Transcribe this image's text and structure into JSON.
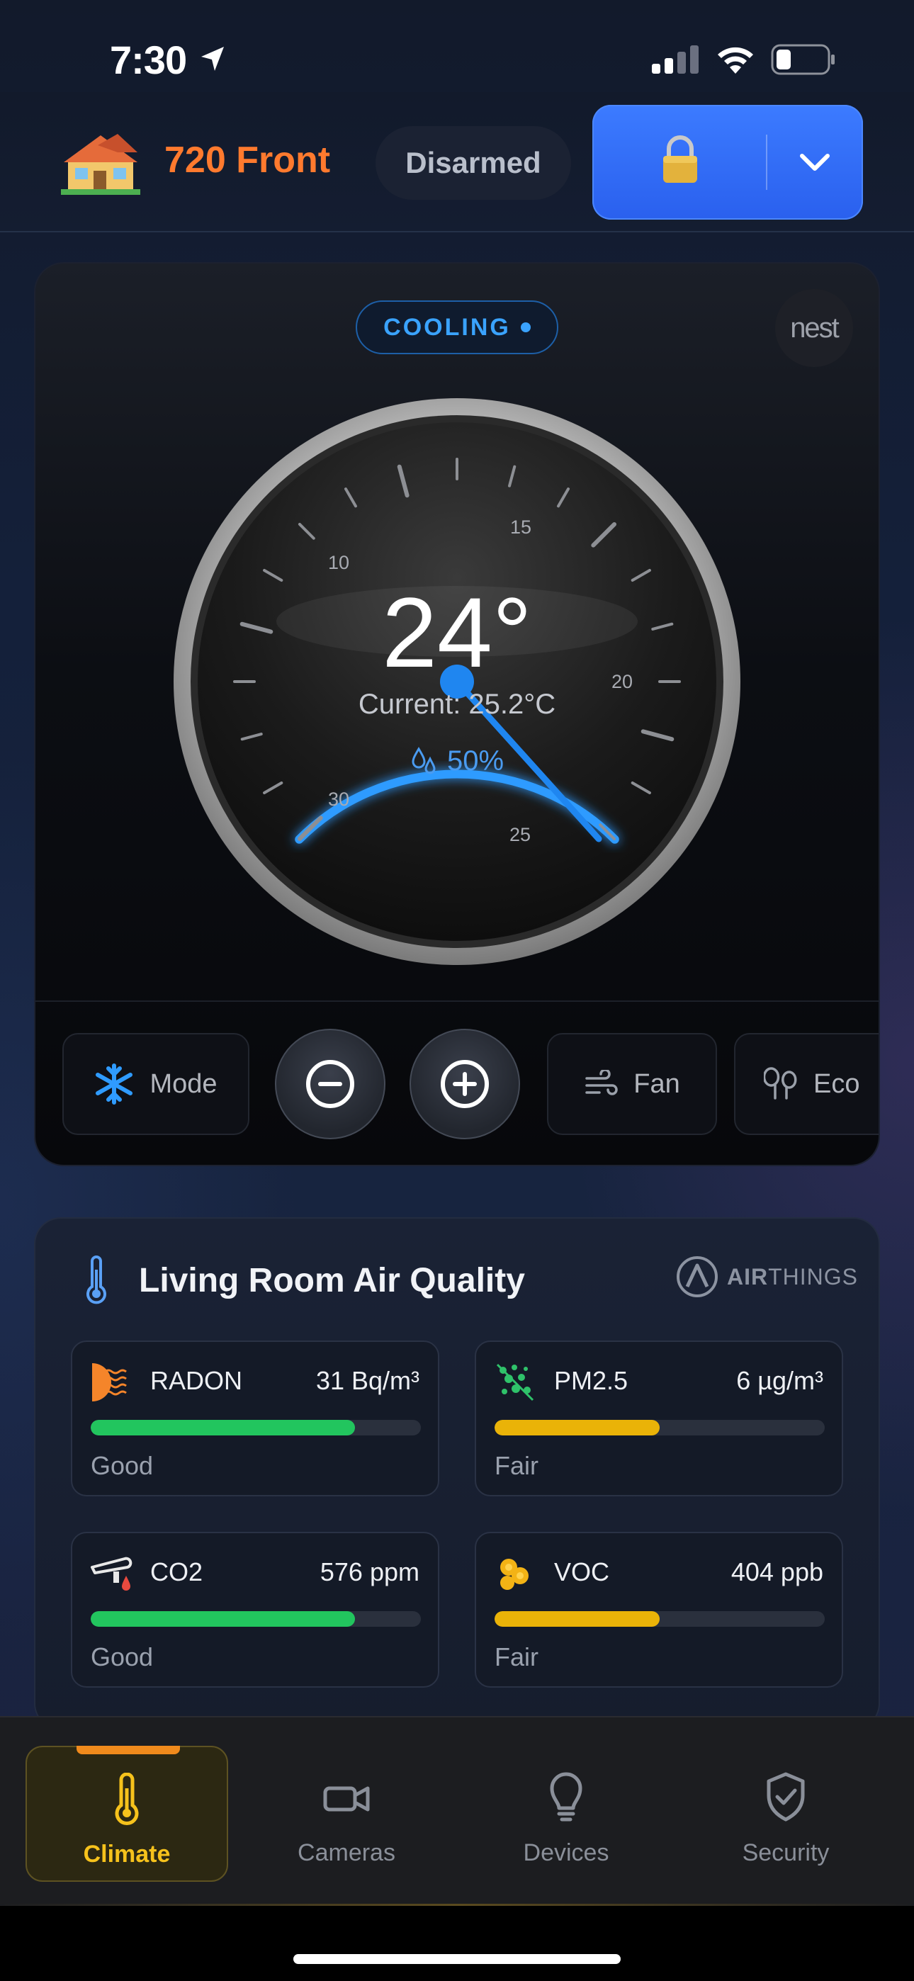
{
  "status_bar": {
    "time": "7:30"
  },
  "header": {
    "location_name": "720 Front",
    "arm_state": "Disarmed"
  },
  "thermostat": {
    "mode_label": "COOLING",
    "brand_badge": "nest",
    "target_temp": "24°",
    "current_temp": "Current: 25.2°C",
    "humidity": "50%",
    "scale_labels": [
      "10",
      "15",
      "20",
      "25",
      "30"
    ],
    "accent_color": "#2f9bff",
    "controls": {
      "mode_label": "Mode",
      "fan_label": "Fan",
      "eco_label": "Eco"
    }
  },
  "air_quality": {
    "title": "Living Room Air Quality",
    "brand": {
      "bold": "AIR",
      "rest": "THINGS"
    },
    "metrics": [
      {
        "name": "RADON",
        "value": "31 Bq/m³",
        "status": "Good",
        "level": 0.8,
        "color": "#22c55e",
        "icon": "radon-icon"
      },
      {
        "name": "PM2.5",
        "value": "6 µg/m³",
        "status": "Fair",
        "level": 0.5,
        "color": "#eab308",
        "icon": "pm25-icon"
      },
      {
        "name": "CO2",
        "value": "576 ppm",
        "status": "Good",
        "level": 0.8,
        "color": "#22c55e",
        "icon": "co2-icon"
      },
      {
        "name": "VOC",
        "value": "404 ppb",
        "status": "Fair",
        "level": 0.5,
        "color": "#eab308",
        "icon": "voc-icon"
      }
    ]
  },
  "tab_bar": {
    "tabs": [
      {
        "label": "Climate",
        "icon": "thermometer-icon",
        "active": true
      },
      {
        "label": "Cameras",
        "icon": "camera-icon",
        "active": false
      },
      {
        "label": "Devices",
        "icon": "lightbulb-icon",
        "active": false
      },
      {
        "label": "Security",
        "icon": "shield-check-icon",
        "active": false
      }
    ]
  }
}
